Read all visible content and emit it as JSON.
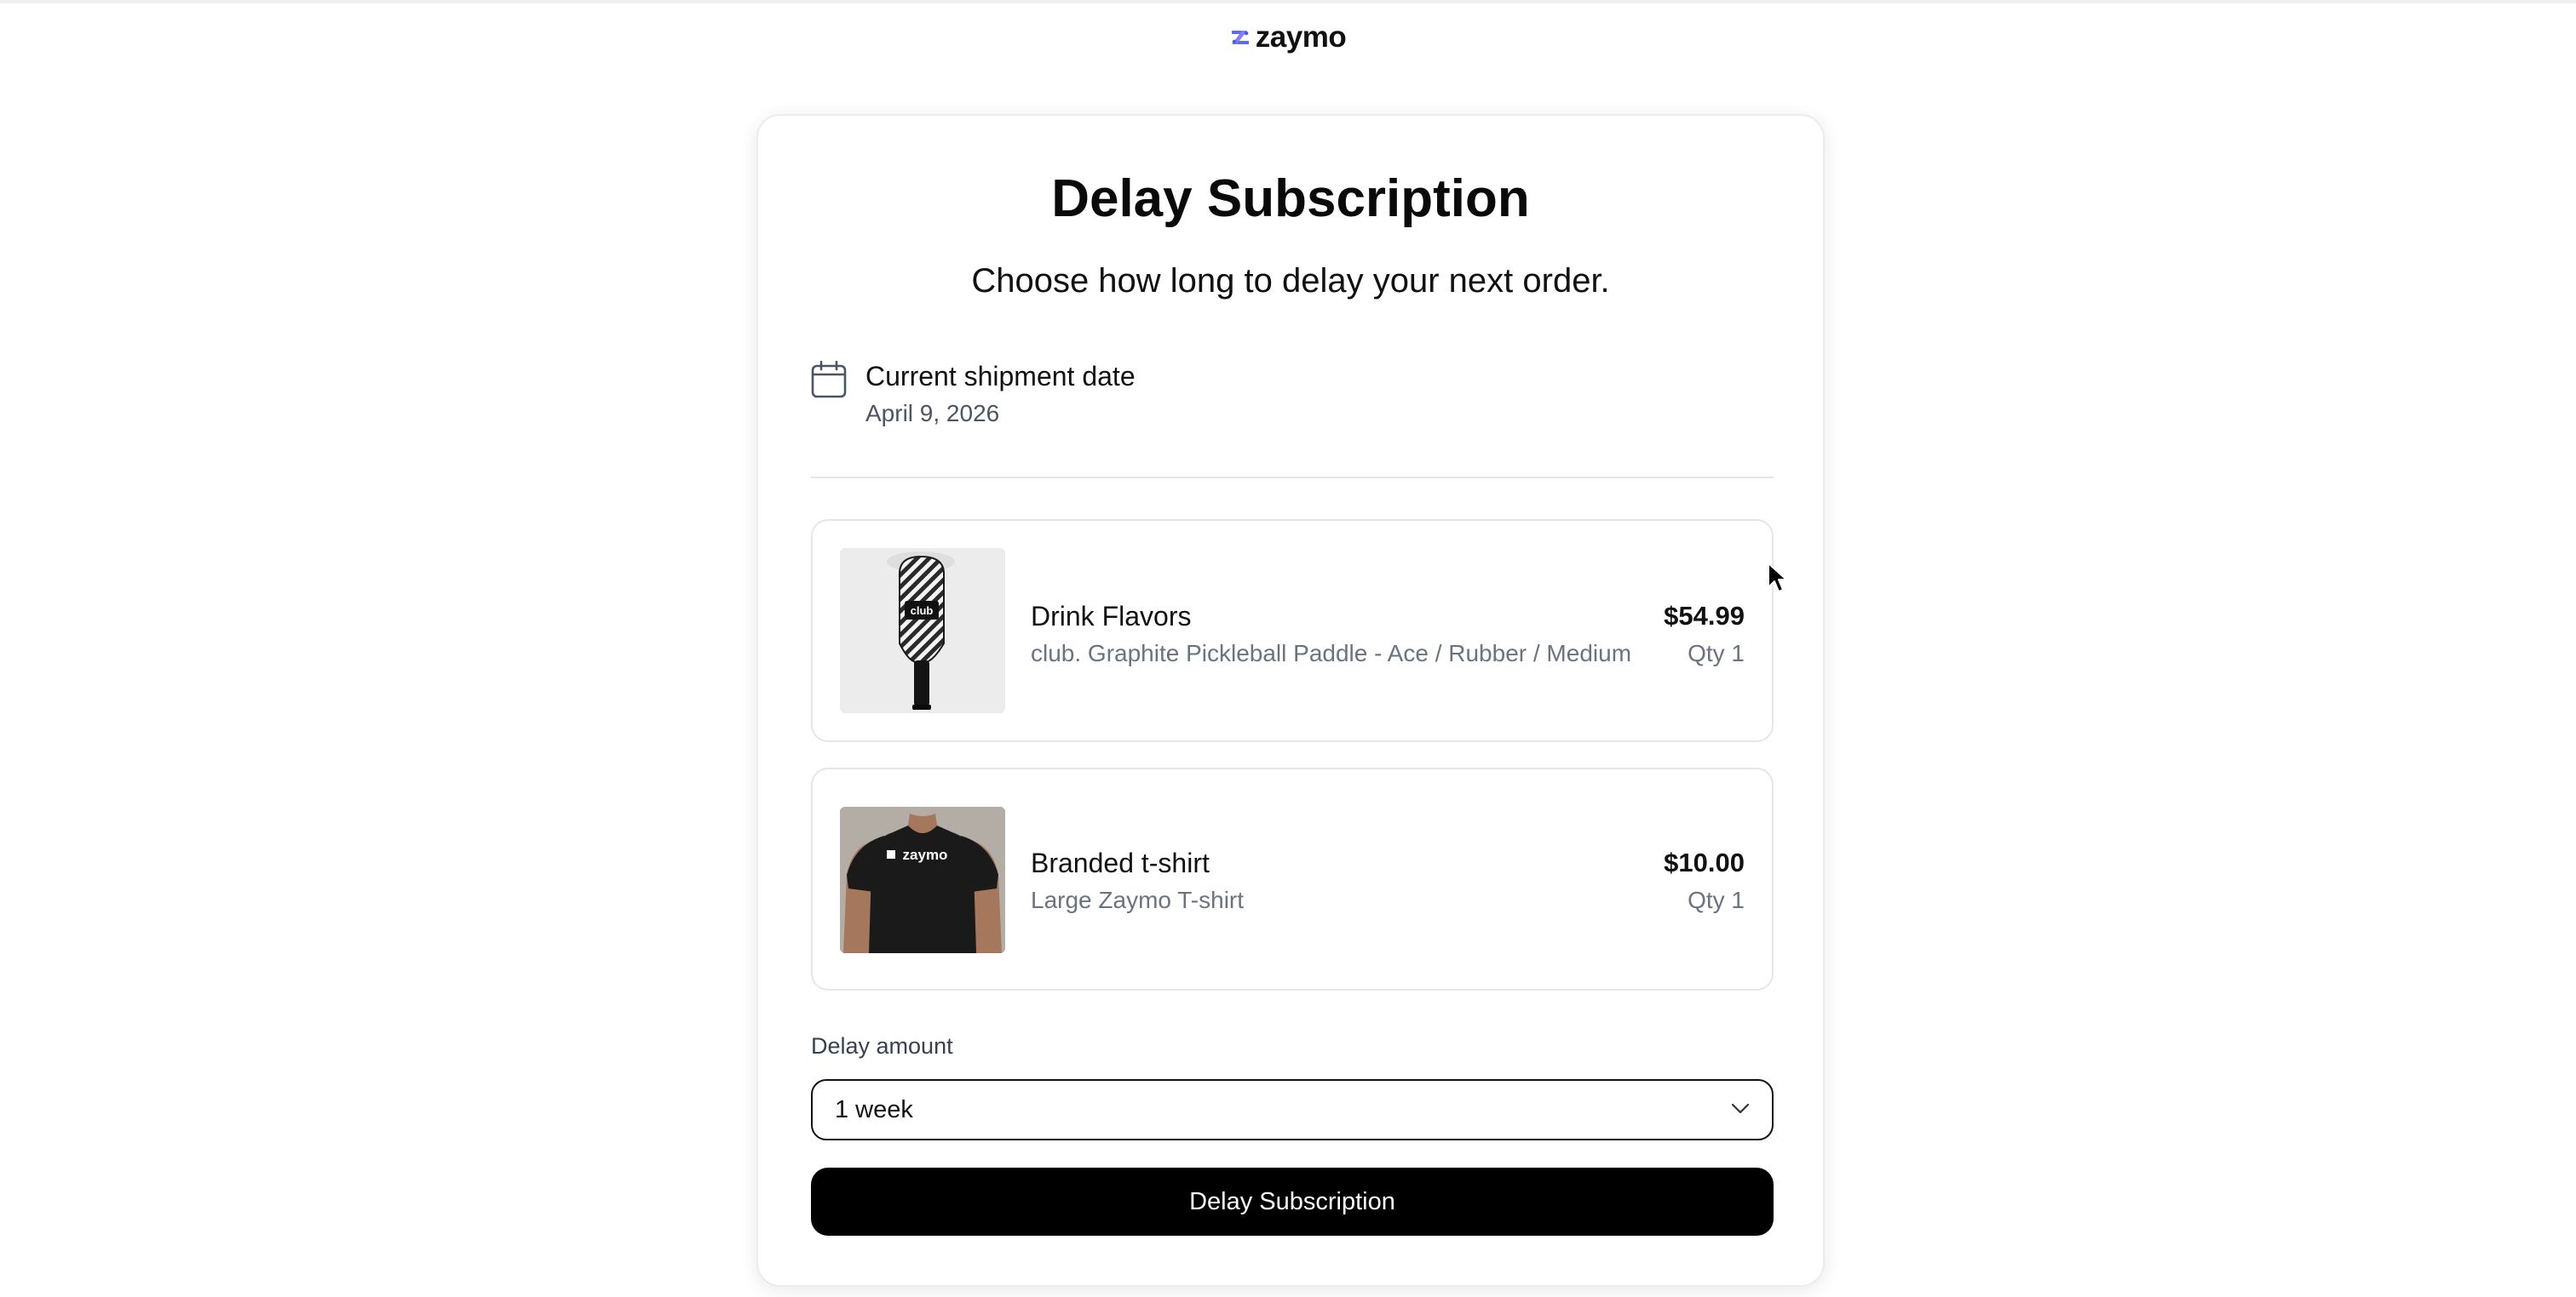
{
  "brand": {
    "name": "zaymo"
  },
  "page": {
    "title": "Delay Subscription",
    "subtitle": "Choose how long to delay your next order."
  },
  "shipment": {
    "icon": "calendar-icon",
    "label": "Current shipment date",
    "date": "April 9, 2026"
  },
  "items": [
    {
      "name": "Drink Flavors",
      "variant": "club. Graphite Pickleball Paddle - Ace / Rubber / Medium",
      "price": "$54.99",
      "qty": "Qty 1",
      "thumb_text": "club"
    },
    {
      "name": "Branded t-shirt",
      "variant": "Large Zaymo T-shirt",
      "price": "$10.00",
      "qty": "Qty 1",
      "thumb_text": "zaymo"
    }
  ],
  "delay": {
    "label": "Delay amount",
    "selected": "1 week",
    "icon": "chevron-down-icon"
  },
  "submit": {
    "label": "Delay Subscription"
  },
  "colors": {
    "accent": "#000000",
    "muted_text": "#6b7280",
    "border": "#e6e6e6"
  }
}
